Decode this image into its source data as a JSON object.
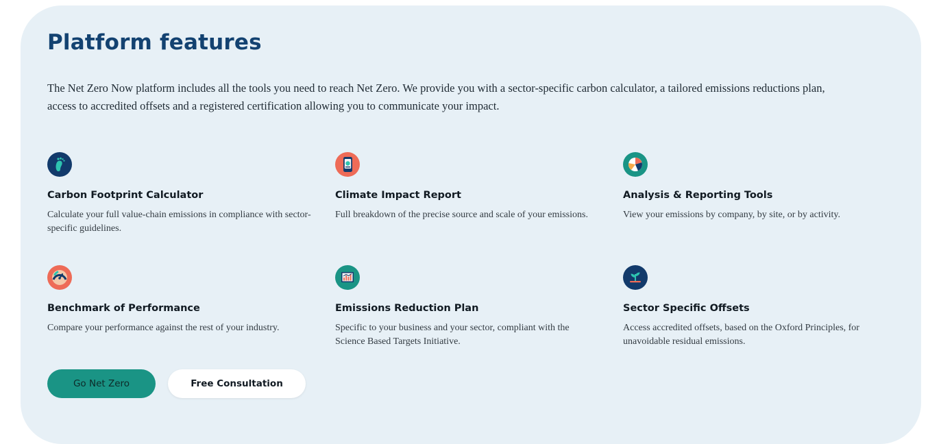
{
  "section": {
    "title": "Platform features",
    "intro": "The Net Zero Now platform includes all the tools you need to reach Net Zero. We provide you with a sector-specific carbon calculator, a tailored emissions reductions plan, access to accredited offsets and a registered certification allowing you to communicate your impact."
  },
  "features": [
    {
      "icon": "footprint-icon",
      "title": "Carbon Footprint Calculator",
      "description": "Calculate your full value-chain emissions in compliance with sector-specific guidelines."
    },
    {
      "icon": "phone-report-icon",
      "title": "Climate Impact Report",
      "description": "Full breakdown of the precise source and scale of your emissions."
    },
    {
      "icon": "pie-chart-icon",
      "title": "Analysis & Reporting Tools",
      "description": "View your emissions by company, by site, or by activity."
    },
    {
      "icon": "speedometer-icon",
      "title": "Benchmark of Performance",
      "description": "Compare your performance against the rest of your industry."
    },
    {
      "icon": "bar-chart-icon",
      "title": "Emissions Reduction Plan",
      "description": "Specific to your business and your sector, compliant with the Science Based Targets Initiative."
    },
    {
      "icon": "sprout-icon",
      "title": "Sector Specific Offsets",
      "description": "Access accredited offsets, based on the Oxford Principles, for unavoidable residual emissions."
    }
  ],
  "buttons": {
    "primary_label": "Go Net Zero",
    "secondary_label": "Free Consultation"
  },
  "colors": {
    "panel_background": "#e7f0f6",
    "heading": "#134271",
    "primary_button": "#1a9485",
    "navy_icon": "#123a6b",
    "coral_icon": "#ee6b57",
    "teal_icon": "#1a9485"
  }
}
